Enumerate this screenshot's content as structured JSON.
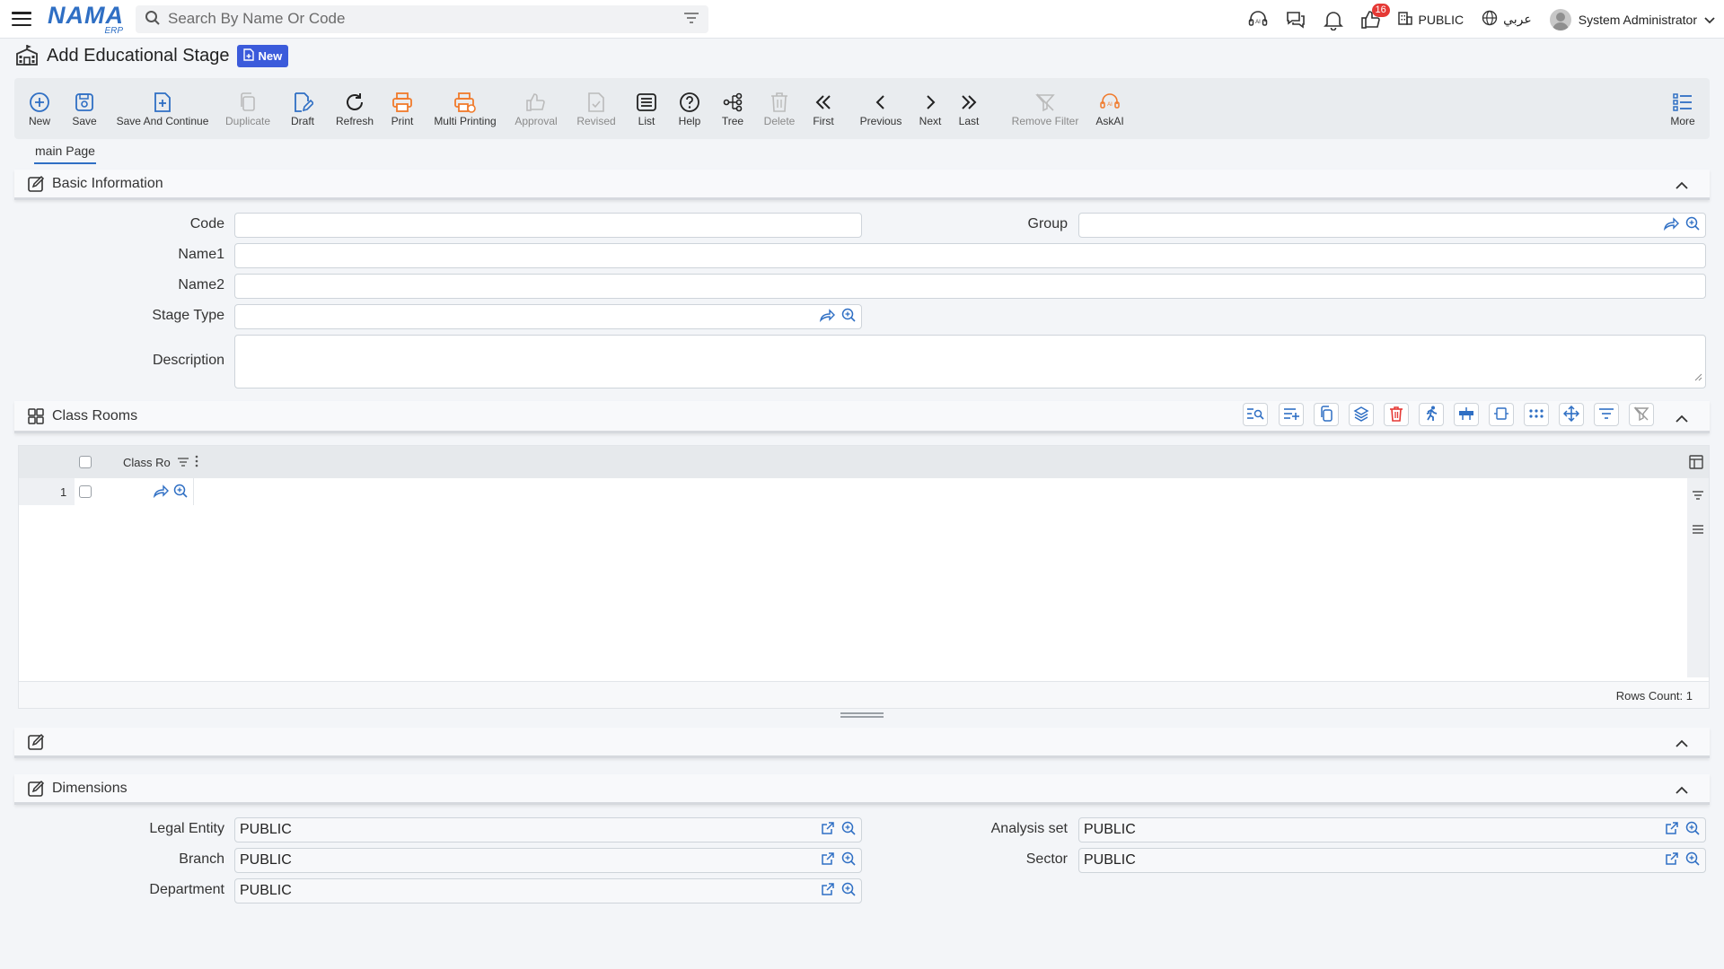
{
  "app": {
    "logo_text": "NAMA",
    "logo_sub": "ERP",
    "search_placeholder": "Search By Name Or Code",
    "notification_count": "16",
    "company": "PUBLIC",
    "language": "عربي",
    "user": "System Administrator"
  },
  "page": {
    "title": "Add Educational Stage",
    "badge": "New"
  },
  "toolbar": {
    "new": "New",
    "save": "Save",
    "save_continue": "Save And Continue",
    "duplicate": "Duplicate",
    "draft": "Draft",
    "refresh": "Refresh",
    "print": "Print",
    "multi_printing": "Multi Printing",
    "approval": "Approval",
    "revised": "Revised",
    "list": "List",
    "help": "Help",
    "tree": "Tree",
    "delete": "Delete",
    "first": "First",
    "previous": "Previous",
    "next": "Next",
    "last": "Last",
    "remove_filter": "Remove Filter",
    "askai": "AskAI",
    "more": "More"
  },
  "tabs": {
    "main": "main Page"
  },
  "basic": {
    "title": "Basic Information",
    "code_label": "Code",
    "code_value": "",
    "group_label": "Group",
    "group_value": "",
    "name1_label": "Name1",
    "name1_value": "",
    "name2_label": "Name2",
    "name2_value": "",
    "stage_type_label": "Stage Type",
    "stage_type_value": "",
    "description_label": "Description",
    "description_value": ""
  },
  "classrooms": {
    "title": "Class Rooms",
    "column": "Class Ro",
    "rows": [
      {
        "num": "1",
        "value": ""
      }
    ],
    "rows_count": "Rows Count: 1"
  },
  "dimensions": {
    "title": "Dimensions",
    "legal_entity_label": "Legal Entity",
    "legal_entity_value": "PUBLIC",
    "analysis_set_label": "Analysis set",
    "analysis_set_value": "PUBLIC",
    "branch_label": "Branch",
    "branch_value": "PUBLIC",
    "sector_label": "Sector",
    "sector_value": "PUBLIC",
    "department_label": "Department",
    "department_value": "PUBLIC"
  },
  "colors": {
    "accent": "#2f6fc4",
    "orange": "#f07a2b",
    "badge": "#3b5bdb"
  }
}
